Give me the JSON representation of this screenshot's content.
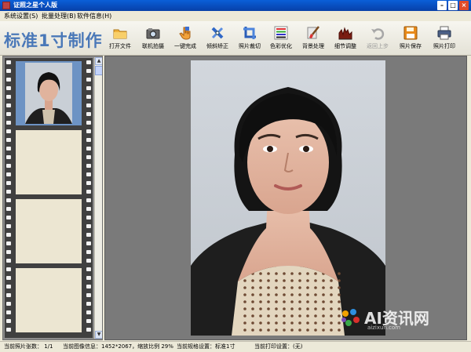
{
  "window": {
    "title": "证照之星个人版",
    "controls": [
      "–",
      "□",
      "×"
    ]
  },
  "menu": [
    {
      "label": "系统设置(S)"
    },
    {
      "label": "批量处理(B)"
    },
    {
      "label": "软件信息(H)"
    }
  ],
  "brand": {
    "text": "标准1寸制作"
  },
  "toolbar": [
    {
      "label": "打开文件",
      "icon": "folder-icon",
      "enabled": true
    },
    {
      "label": "联机拍摄",
      "icon": "camera-icon",
      "enabled": true
    },
    {
      "label": "一键完成",
      "icon": "hand-pointer-icon",
      "enabled": true
    },
    {
      "label": "倾斜矫正",
      "icon": "rotate-tools-icon",
      "enabled": true
    },
    {
      "label": "照片裁切",
      "icon": "crop-icon",
      "enabled": true
    },
    {
      "label": "色彩优化",
      "icon": "color-bars-icon",
      "enabled": true
    },
    {
      "label": "背景处理",
      "icon": "brush-icon",
      "enabled": true
    },
    {
      "label": "细节调整",
      "icon": "levels-icon",
      "enabled": true
    },
    {
      "label": "返回上步",
      "icon": "undo-icon",
      "enabled": false
    },
    {
      "label": "照片保存",
      "icon": "floppy-icon",
      "enabled": true
    },
    {
      "label": "照片打印",
      "icon": "printer-icon",
      "enabled": true
    }
  ],
  "filmstrip": {
    "frames": 4,
    "selected": 0
  },
  "status": {
    "count": "当前照片张数： 1/1",
    "image_info": "当前图像信息：1452*2067，缩放比例 29%",
    "spec": "当前规格设置：标准1寸",
    "print": "当前打印设置：(无)"
  },
  "watermark": {
    "text": "AI资讯网",
    "sub": "aizixun.com"
  },
  "colors": {
    "title_bar": "#0740a8",
    "brand": "#4a78b8",
    "canvas_bg": "#7a7a7a",
    "photo_bg": "#c9cfd6",
    "film": "#404040",
    "frame_empty": "#ece6d2",
    "frame_selected": "#6d93c4"
  }
}
